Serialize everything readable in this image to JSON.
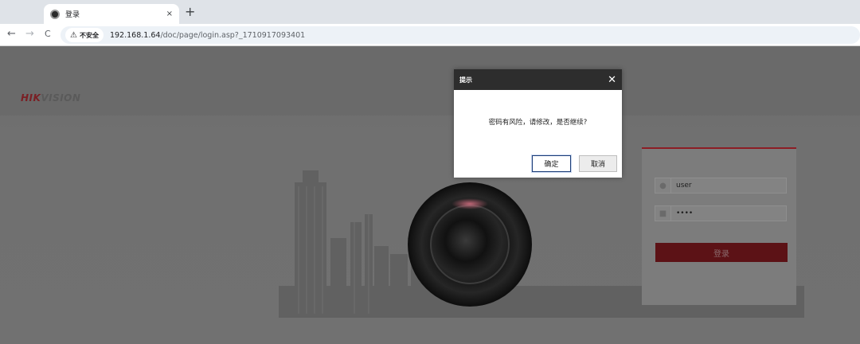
{
  "browser": {
    "tab_title": "登录",
    "tab_close": "×",
    "new_tab": "+",
    "back": "←",
    "forward": "→",
    "reload": "C",
    "security_icon": "warning-triangle-icon",
    "security_label": "不安全",
    "url_host": "192.168.1.64",
    "url_path": "/doc/page/login.asp?_1710917093401"
  },
  "page": {
    "logo_part1": "HIK",
    "logo_part2": "VISION",
    "login": {
      "username": "user",
      "password_mask": "••••",
      "login_button": "登录",
      "user_icon": "user-icon",
      "lock_icon": "lock-icon"
    }
  },
  "dialog": {
    "title": "提示",
    "close": "✕",
    "message": "密码有风险，请修改，是否继续?",
    "ok": "确定",
    "cancel": "取消"
  },
  "colors": {
    "brand_red": "#8c1e25",
    "dialog_header": "#2d2d2d"
  }
}
